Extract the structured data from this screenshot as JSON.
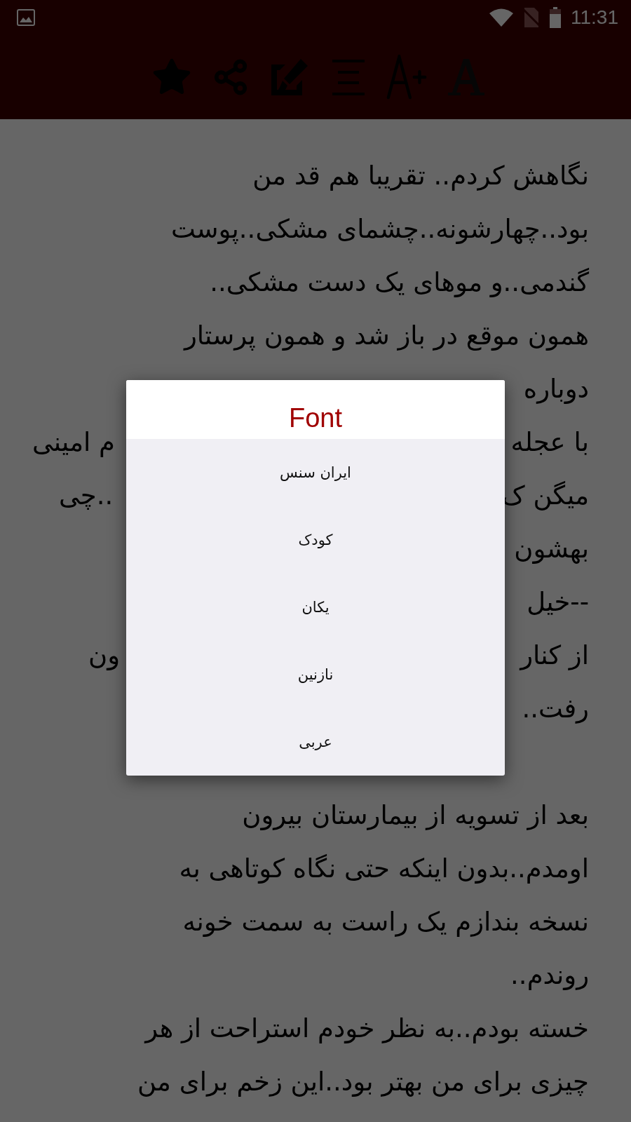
{
  "status_bar": {
    "time": "11:31"
  },
  "dialog": {
    "title": "Font",
    "options": [
      "ایران سنس",
      "کودک",
      "یکان",
      "نازنین",
      "عربی"
    ]
  },
  "paragraphs": [
    [
      {
        "right": "نگاهش کردم.. تقریبا هم قد من"
      },
      {
        "right": "بود..چهارشونه..چشمای مشکی..پوست"
      },
      {
        "right": "گندمی..و موهای یک دست مشکی.."
      },
      {
        "right": "همون موقع در باز شد و همون پرستار"
      },
      {
        "right": "دوباره"
      },
      {
        "right": "با عجله",
        "left": "م امینی"
      },
      {
        "right": "میگن ک",
        "left": "..چی"
      },
      {
        "right": "بهشون"
      },
      {
        "right": "--خیل"
      },
      {
        "right": "از کنار",
        "left": "ون"
      },
      {
        "right": "رفت.."
      }
    ],
    [
      {
        "right": "بعد از تسویه از بیمارستان بیرون"
      },
      {
        "right": "اومدم..بدون اینکه حتی نگاه کوتاهی به"
      },
      {
        "right": "نسخه بندازم یک راست به سمت خونه"
      },
      {
        "right": "روندم.."
      },
      {
        "right": "خسته بودم..به نظر خودم استراحت از هر"
      },
      {
        "right": "چیزی برای من بهتر بود..این زخم برای من"
      }
    ]
  ]
}
